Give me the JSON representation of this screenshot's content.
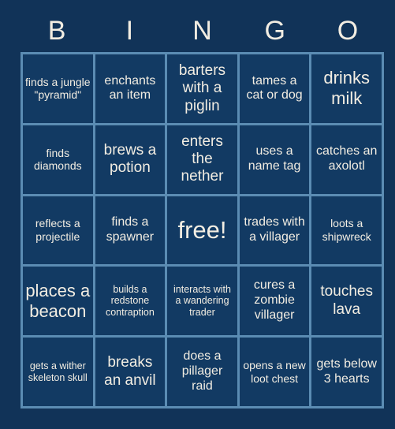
{
  "card": {
    "title_letters": [
      "B",
      "I",
      "N",
      "G",
      "O"
    ],
    "background_color": "#113358",
    "cell_color": "#123a63",
    "grid_line_color": "#5b8cb3",
    "text_color": "#f2ede2"
  },
  "cells": [
    {
      "text": "finds a jungle \"pyramid\"",
      "size": "sm"
    },
    {
      "text": "enchants an item",
      "size": "md"
    },
    {
      "text": "barters with a piglin",
      "size": "lg"
    },
    {
      "text": "tames a cat or dog",
      "size": "md"
    },
    {
      "text": "drinks milk",
      "size": "xl"
    },
    {
      "text": "finds diamonds",
      "size": "sm"
    },
    {
      "text": "brews a potion",
      "size": "lg"
    },
    {
      "text": "enters the nether",
      "size": "lg"
    },
    {
      "text": "uses a name tag",
      "size": "md"
    },
    {
      "text": "catches an axolotl",
      "size": "md"
    },
    {
      "text": "reflects a projectile",
      "size": "sm"
    },
    {
      "text": "finds a spawner",
      "size": "md"
    },
    {
      "text": "free!",
      "size": "free"
    },
    {
      "text": "trades with a villager",
      "size": "md"
    },
    {
      "text": "loots a shipwreck",
      "size": "sm"
    },
    {
      "text": "places a beacon",
      "size": "xl"
    },
    {
      "text": "builds a redstone contraption",
      "size": "xs"
    },
    {
      "text": "interacts with a wandering trader",
      "size": "xs"
    },
    {
      "text": "cures a zombie villager",
      "size": "md"
    },
    {
      "text": "touches lava",
      "size": "lg"
    },
    {
      "text": "gets a wither skeleton skull",
      "size": "xs"
    },
    {
      "text": "breaks an anvil",
      "size": "lg"
    },
    {
      "text": "does a pillager raid",
      "size": "md"
    },
    {
      "text": "opens a new loot chest",
      "size": "sm"
    },
    {
      "text": "gets below 3 hearts",
      "size": "md"
    }
  ]
}
